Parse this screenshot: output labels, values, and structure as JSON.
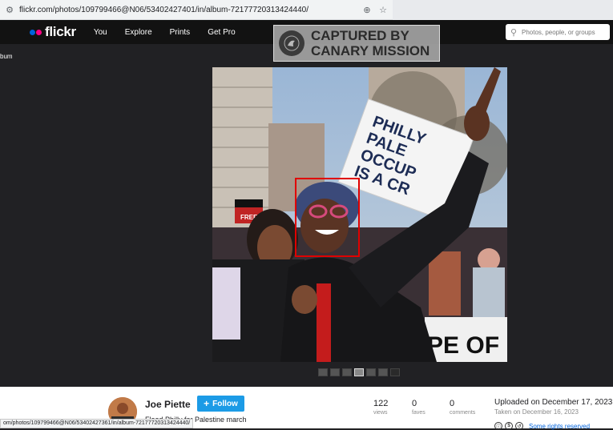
{
  "browser": {
    "url": "flickr.com/photos/109799466@N06/53402427401/in/album-72177720313424440/"
  },
  "nav": {
    "logo": "flickr",
    "links": [
      "You",
      "Explore",
      "Prints",
      "Get Pro"
    ],
    "search_placeholder": "Photos, people, or groups"
  },
  "watermark": {
    "line1": "CAPTURED BY",
    "line2": "CANARY MISSION"
  },
  "album_crumb": "bum",
  "photo": {
    "sign_text": [
      "PHILLY",
      "PALE",
      "OCCUP",
      "IS A CR"
    ],
    "flag_text": "FREE",
    "banner_text": "PE OF P"
  },
  "info": {
    "author": "Joe Piette",
    "follow_label": "Follow",
    "title": "Flood Philly for Palestine march",
    "stats": [
      {
        "num": "122",
        "label": "views"
      },
      {
        "num": "0",
        "label": "faves"
      },
      {
        "num": "0",
        "label": "comments"
      }
    ],
    "uploaded": "Uploaded on December 17, 2023",
    "taken": "Taken on December 16, 2023",
    "rights": "Some rights reserved"
  },
  "statusbar": "om/photos/109799466@N06/53402427361/in/album-72177720313424440/",
  "colors": {
    "flickr_blue": "#0063dc",
    "flickr_pink": "#ff0084",
    "follow_button": "#1c9be6",
    "face_box": "#e00000"
  }
}
